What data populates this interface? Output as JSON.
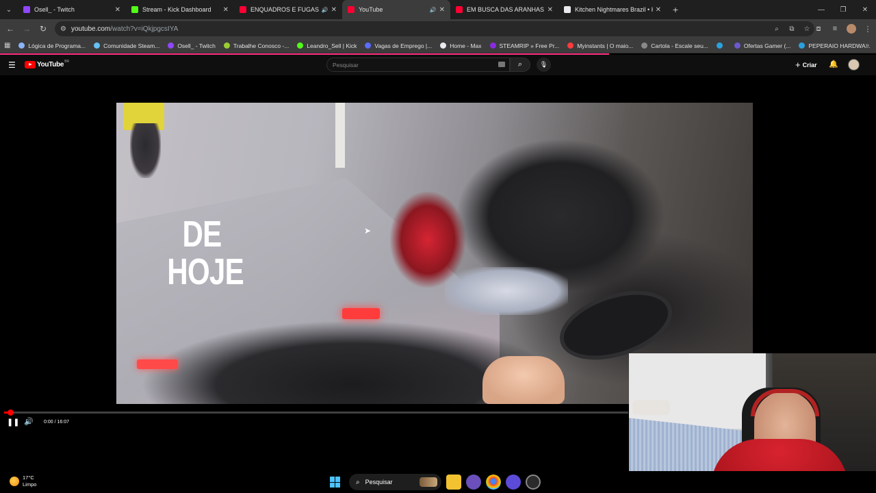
{
  "browser": {
    "tabs": [
      {
        "title": "Osell_ - Twitch",
        "color": "#9146ff",
        "active": false,
        "audio": false
      },
      {
        "title": "Stream - Kick Dashboard",
        "color": "#53fc18",
        "active": false,
        "audio": false
      },
      {
        "title": "ENQUADROS E FUGAS DE M",
        "color": "#ff0033",
        "active": false,
        "audio": true
      },
      {
        "title": "YouTube",
        "color": "#ff0033",
        "active": true,
        "audio": true
      },
      {
        "title": "EM BUSCA DAS ARANHAS TAR",
        "color": "#ff0033",
        "active": false,
        "audio": false
      },
      {
        "title": "Kitchen Nightmares Brazil • HB",
        "color": "#e8eaed",
        "active": false,
        "audio": false
      }
    ],
    "url_host": "youtube.com",
    "url_path": "/watch?v=iQkjpgcsIYA",
    "bookmarks": [
      {
        "label": "Lógica de Programa...",
        "color": "#8ab4f8"
      },
      {
        "label": "Comunidade Steam...",
        "color": "#66c0f4"
      },
      {
        "label": "Osell_ - Twitch",
        "color": "#9146ff"
      },
      {
        "label": "Trabalhe Conosco -...",
        "color": "#9acd32"
      },
      {
        "label": "Leandro_Sell | Kick",
        "color": "#53fc18"
      },
      {
        "label": "Vagas de Emprego |...",
        "color": "#5b6cff"
      },
      {
        "label": "Home - Max",
        "color": "#e8eaed"
      },
      {
        "label": "STEAMRIP » Free Pr...",
        "color": "#8a2be2"
      },
      {
        "label": "Myinstants | O maio...",
        "color": "#ff3b3b"
      },
      {
        "label": "Cartola - Escale seu...",
        "color": "#888888"
      },
      {
        "label": "",
        "color": "#2aa1de"
      },
      {
        "label": "Ofertas Gamer (...",
        "color": "#6a5acd"
      },
      {
        "label": "PEPERAIO HARDWA...",
        "color": "#2aa1de"
      }
    ]
  },
  "youtube": {
    "logo_text": "YouTube",
    "logo_country": "BR",
    "search_placeholder": "Pesquisar",
    "create_label": "Criar"
  },
  "video": {
    "overlay_line1": "DE",
    "overlay_line2": "HOJE",
    "time_current": "0:00",
    "time_total": "16:07",
    "progress_fraction": 0.01
  },
  "taskbar": {
    "temperature": "17°C",
    "weather": "Limpo",
    "search_label": "Pesquisar"
  },
  "colors": {
    "youtube_red": "#ff0000",
    "accent_pink": "#ff2e7e",
    "windows_blue": "#4cc2ff"
  }
}
